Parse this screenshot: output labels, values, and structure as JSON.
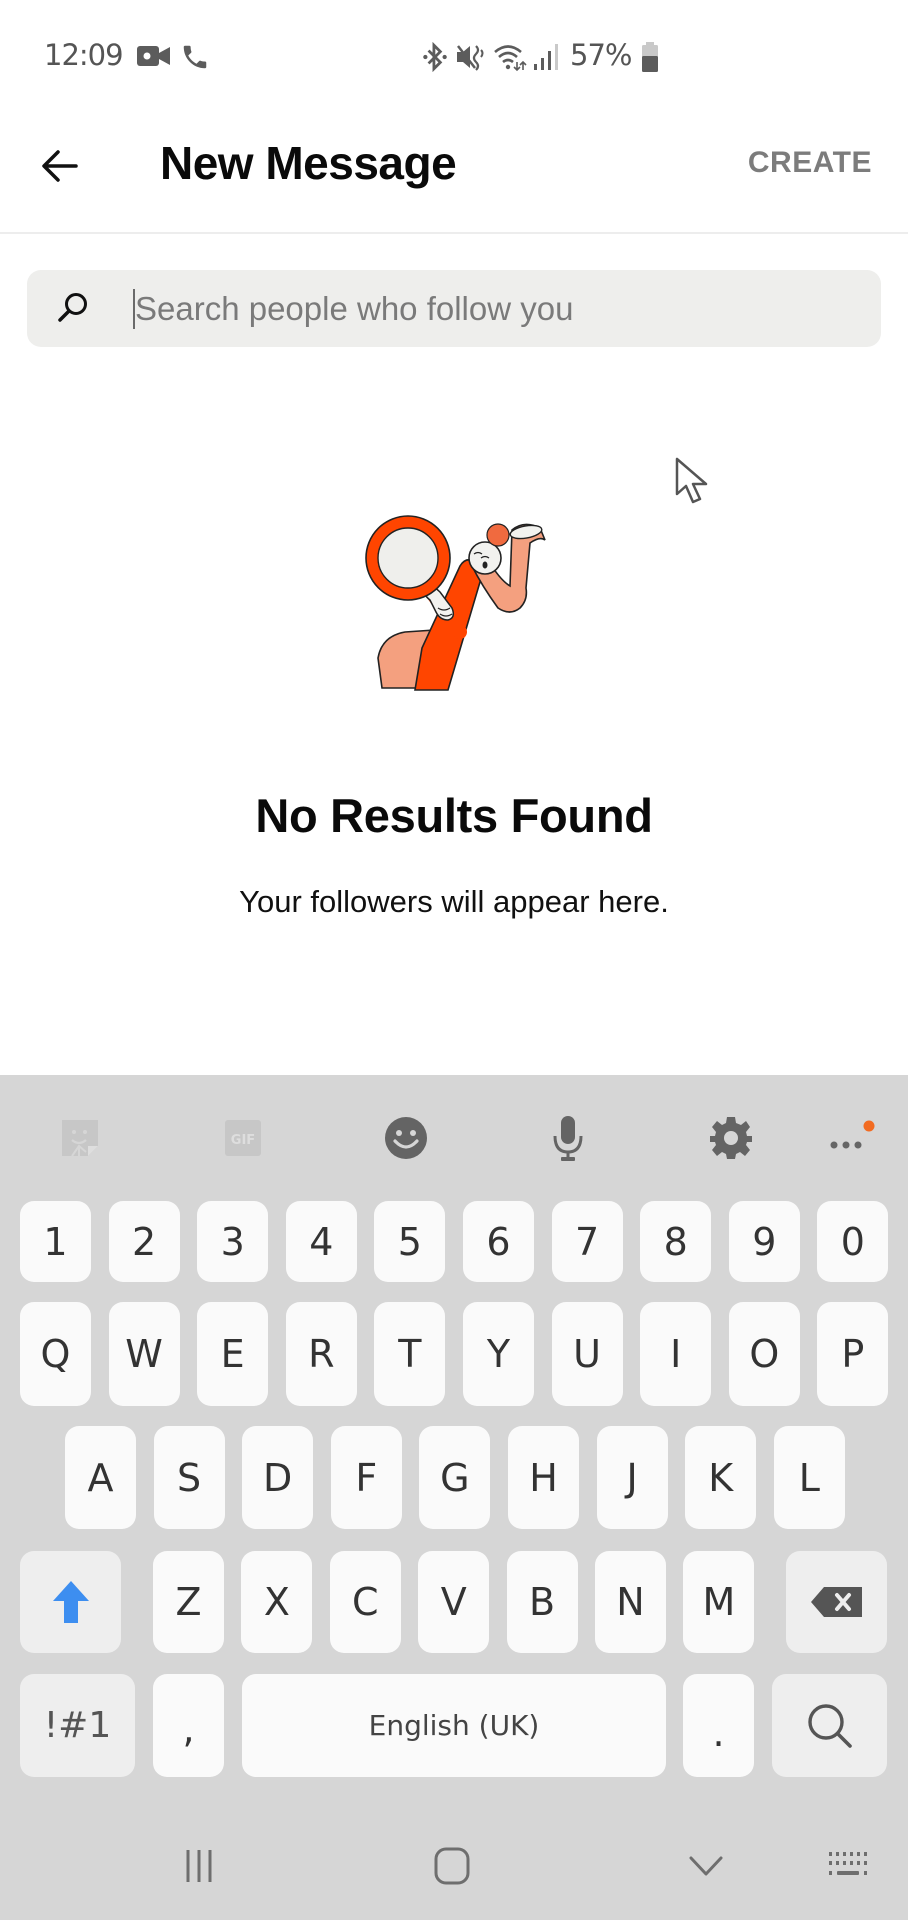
{
  "status_bar": {
    "time": "12:09",
    "battery_percent": "57%",
    "icons": [
      "video-call-icon",
      "phone-call-icon",
      "bluetooth-icon",
      "mute-vibrate-icon",
      "wifi-icon",
      "signal-icon",
      "battery-icon"
    ]
  },
  "header": {
    "back_icon": "arrow-left-icon",
    "title": "New Message",
    "create_label": "CREATE"
  },
  "search": {
    "placeholder": "Search people who follow you",
    "value": ""
  },
  "empty_state": {
    "illustration": "person-with-magnifying-glass",
    "title": "No Results Found",
    "subtitle": "Your followers will appear here."
  },
  "keyboard": {
    "toolbar": [
      {
        "name": "sticker-icon"
      },
      {
        "name": "gif-icon",
        "label": "GIF"
      },
      {
        "name": "emoji-icon"
      },
      {
        "name": "microphone-icon"
      },
      {
        "name": "settings-gear-icon"
      },
      {
        "name": "more-options-icon",
        "badge_color": "#f26b21"
      }
    ],
    "rows": {
      "numbers": [
        "1",
        "2",
        "3",
        "4",
        "5",
        "6",
        "7",
        "8",
        "9",
        "0"
      ],
      "row1": [
        "Q",
        "W",
        "E",
        "R",
        "T",
        "Y",
        "U",
        "I",
        "O",
        "P"
      ],
      "row2": [
        "A",
        "S",
        "D",
        "F",
        "G",
        "H",
        "J",
        "K",
        "L"
      ],
      "row3": [
        "Z",
        "X",
        "C",
        "V",
        "B",
        "N",
        "M"
      ]
    },
    "symbols_label": "!#1",
    "comma_label": ",",
    "space_label": "English (UK)",
    "period_label": ".",
    "shift_color": "#3d8ef0"
  },
  "nav_bar": {
    "recents_icon": "recent-apps-icon",
    "home_icon": "home-icon",
    "back_icon": "hide-keyboard-chevron-icon",
    "keyboard_icon": "keyboard-switch-icon"
  },
  "colors": {
    "accent_orange": "#ff4500",
    "peach": "#f4a07f",
    "keyboard_bg": "#d6d6d6",
    "key_bg": "#fafafa"
  }
}
